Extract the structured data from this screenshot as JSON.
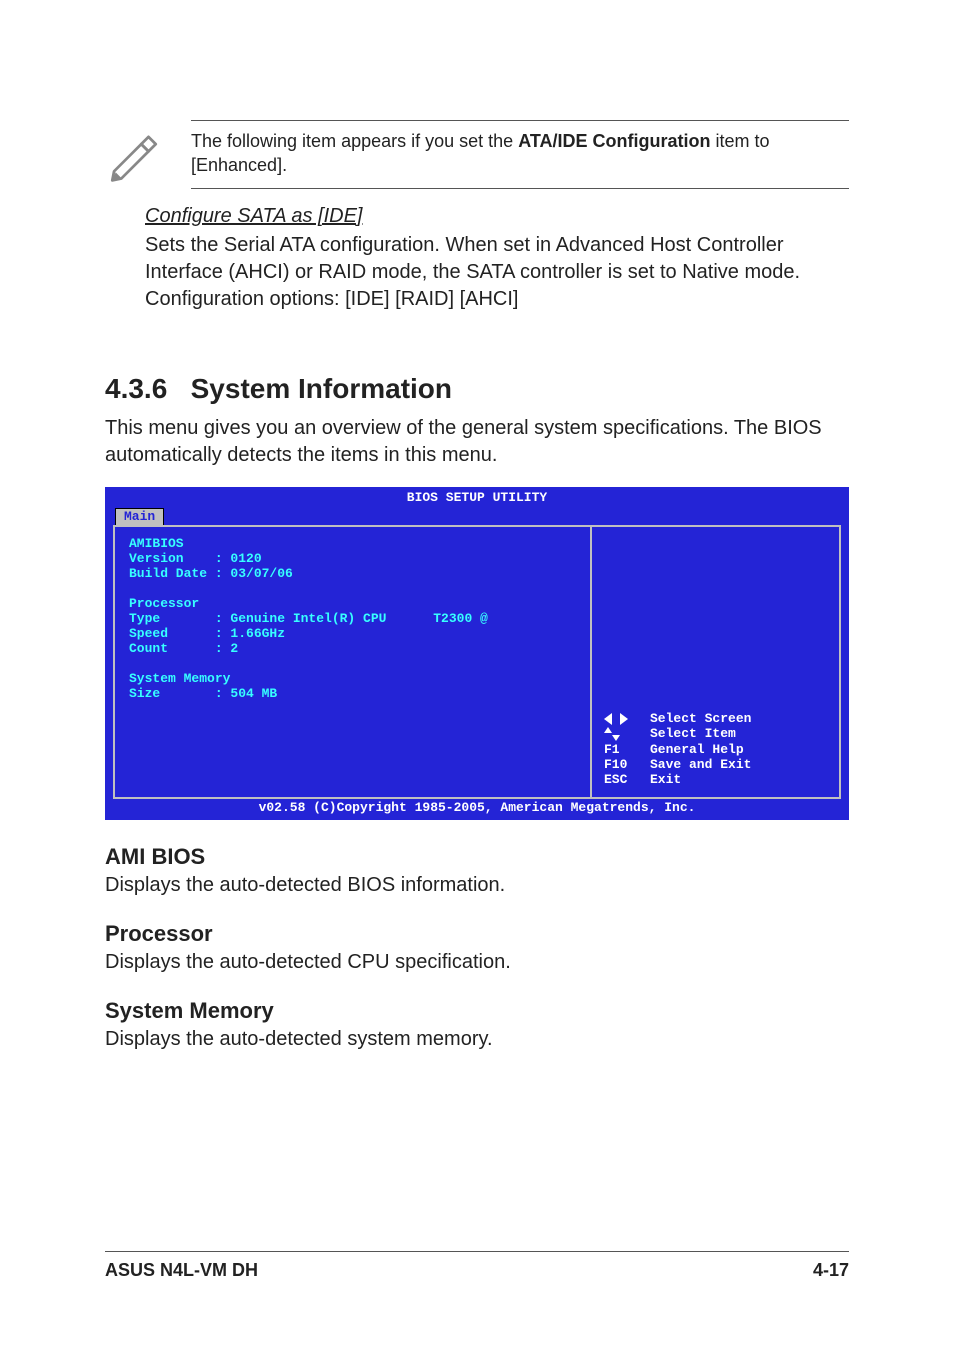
{
  "note": {
    "prefix": "The following item appears if you set the ",
    "bold": "ATA/IDE Configuration",
    "suffix": " item to [Enhanced]."
  },
  "subsection": {
    "title": "Configure SATA as [IDE]",
    "body": "Sets the Serial ATA configuration. When set in Advanced Host Controller Interface (AHCI) or RAID mode, the SATA controller is set to Native mode. Configuration options: [IDE] [RAID] [AHCI]"
  },
  "section": {
    "number": "4.3.6",
    "title": "System Information",
    "intro": "This menu gives you an overview of the general system specifications. The BIOS automatically detects the items in this menu."
  },
  "bios": {
    "title": "BIOS SETUP UTILITY",
    "tab": "Main",
    "left_text": "AMIBIOS\nVersion    : 0120\nBuild Date : 03/07/06\n\nProcessor\nType       : Genuine Intel(R) CPU      T2300 @\nSpeed      : 1.66GHz\nCount      : 2\n\nSystem Memory\nSize       : 504 MB",
    "legend": [
      {
        "key_icon": "lr",
        "label": "Select Screen"
      },
      {
        "key_icon": "ud",
        "label": "Select Item"
      },
      {
        "key_text": "F1",
        "label": "General Help"
      },
      {
        "key_text": "F10",
        "label": "Save and Exit"
      },
      {
        "key_text": "ESC",
        "label": "Exit"
      }
    ],
    "footer": "v02.58 (C)Copyright 1985-2005, American Megatrends, Inc."
  },
  "subsections_after": [
    {
      "heading": "AMI BIOS",
      "desc": "Displays the auto-detected BIOS information."
    },
    {
      "heading": "Processor",
      "desc": "Displays the auto-detected CPU specification."
    },
    {
      "heading": "System Memory",
      "desc": "Displays the auto-detected system memory."
    }
  ],
  "footer": {
    "left": "ASUS N4L-VM DH",
    "right": "4-17"
  }
}
